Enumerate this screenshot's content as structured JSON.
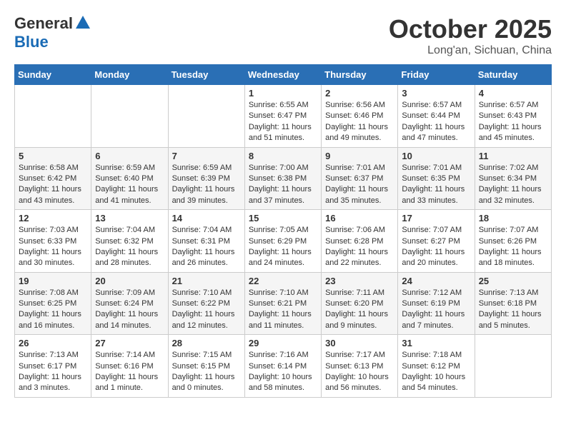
{
  "header": {
    "logo_general": "General",
    "logo_blue": "Blue",
    "month_title": "October 2025",
    "location": "Long'an, Sichuan, China"
  },
  "days_of_week": [
    "Sunday",
    "Monday",
    "Tuesday",
    "Wednesday",
    "Thursday",
    "Friday",
    "Saturday"
  ],
  "weeks": [
    {
      "days": [
        {
          "num": "",
          "info": ""
        },
        {
          "num": "",
          "info": ""
        },
        {
          "num": "",
          "info": ""
        },
        {
          "num": "1",
          "info": "Sunrise: 6:55 AM\nSunset: 6:47 PM\nDaylight: 11 hours\nand 51 minutes."
        },
        {
          "num": "2",
          "info": "Sunrise: 6:56 AM\nSunset: 6:46 PM\nDaylight: 11 hours\nand 49 minutes."
        },
        {
          "num": "3",
          "info": "Sunrise: 6:57 AM\nSunset: 6:44 PM\nDaylight: 11 hours\nand 47 minutes."
        },
        {
          "num": "4",
          "info": "Sunrise: 6:57 AM\nSunset: 6:43 PM\nDaylight: 11 hours\nand 45 minutes."
        }
      ]
    },
    {
      "days": [
        {
          "num": "5",
          "info": "Sunrise: 6:58 AM\nSunset: 6:42 PM\nDaylight: 11 hours\nand 43 minutes."
        },
        {
          "num": "6",
          "info": "Sunrise: 6:59 AM\nSunset: 6:40 PM\nDaylight: 11 hours\nand 41 minutes."
        },
        {
          "num": "7",
          "info": "Sunrise: 6:59 AM\nSunset: 6:39 PM\nDaylight: 11 hours\nand 39 minutes."
        },
        {
          "num": "8",
          "info": "Sunrise: 7:00 AM\nSunset: 6:38 PM\nDaylight: 11 hours\nand 37 minutes."
        },
        {
          "num": "9",
          "info": "Sunrise: 7:01 AM\nSunset: 6:37 PM\nDaylight: 11 hours\nand 35 minutes."
        },
        {
          "num": "10",
          "info": "Sunrise: 7:01 AM\nSunset: 6:35 PM\nDaylight: 11 hours\nand 33 minutes."
        },
        {
          "num": "11",
          "info": "Sunrise: 7:02 AM\nSunset: 6:34 PM\nDaylight: 11 hours\nand 32 minutes."
        }
      ]
    },
    {
      "days": [
        {
          "num": "12",
          "info": "Sunrise: 7:03 AM\nSunset: 6:33 PM\nDaylight: 11 hours\nand 30 minutes."
        },
        {
          "num": "13",
          "info": "Sunrise: 7:04 AM\nSunset: 6:32 PM\nDaylight: 11 hours\nand 28 minutes."
        },
        {
          "num": "14",
          "info": "Sunrise: 7:04 AM\nSunset: 6:31 PM\nDaylight: 11 hours\nand 26 minutes."
        },
        {
          "num": "15",
          "info": "Sunrise: 7:05 AM\nSunset: 6:29 PM\nDaylight: 11 hours\nand 24 minutes."
        },
        {
          "num": "16",
          "info": "Sunrise: 7:06 AM\nSunset: 6:28 PM\nDaylight: 11 hours\nand 22 minutes."
        },
        {
          "num": "17",
          "info": "Sunrise: 7:07 AM\nSunset: 6:27 PM\nDaylight: 11 hours\nand 20 minutes."
        },
        {
          "num": "18",
          "info": "Sunrise: 7:07 AM\nSunset: 6:26 PM\nDaylight: 11 hours\nand 18 minutes."
        }
      ]
    },
    {
      "days": [
        {
          "num": "19",
          "info": "Sunrise: 7:08 AM\nSunset: 6:25 PM\nDaylight: 11 hours\nand 16 minutes."
        },
        {
          "num": "20",
          "info": "Sunrise: 7:09 AM\nSunset: 6:24 PM\nDaylight: 11 hours\nand 14 minutes."
        },
        {
          "num": "21",
          "info": "Sunrise: 7:10 AM\nSunset: 6:22 PM\nDaylight: 11 hours\nand 12 minutes."
        },
        {
          "num": "22",
          "info": "Sunrise: 7:10 AM\nSunset: 6:21 PM\nDaylight: 11 hours\nand 11 minutes."
        },
        {
          "num": "23",
          "info": "Sunrise: 7:11 AM\nSunset: 6:20 PM\nDaylight: 11 hours\nand 9 minutes."
        },
        {
          "num": "24",
          "info": "Sunrise: 7:12 AM\nSunset: 6:19 PM\nDaylight: 11 hours\nand 7 minutes."
        },
        {
          "num": "25",
          "info": "Sunrise: 7:13 AM\nSunset: 6:18 PM\nDaylight: 11 hours\nand 5 minutes."
        }
      ]
    },
    {
      "days": [
        {
          "num": "26",
          "info": "Sunrise: 7:13 AM\nSunset: 6:17 PM\nDaylight: 11 hours\nand 3 minutes."
        },
        {
          "num": "27",
          "info": "Sunrise: 7:14 AM\nSunset: 6:16 PM\nDaylight: 11 hours\nand 1 minute."
        },
        {
          "num": "28",
          "info": "Sunrise: 7:15 AM\nSunset: 6:15 PM\nDaylight: 11 hours\nand 0 minutes."
        },
        {
          "num": "29",
          "info": "Sunrise: 7:16 AM\nSunset: 6:14 PM\nDaylight: 10 hours\nand 58 minutes."
        },
        {
          "num": "30",
          "info": "Sunrise: 7:17 AM\nSunset: 6:13 PM\nDaylight: 10 hours\nand 56 minutes."
        },
        {
          "num": "31",
          "info": "Sunrise: 7:18 AM\nSunset: 6:12 PM\nDaylight: 10 hours\nand 54 minutes."
        },
        {
          "num": "",
          "info": ""
        }
      ]
    }
  ]
}
